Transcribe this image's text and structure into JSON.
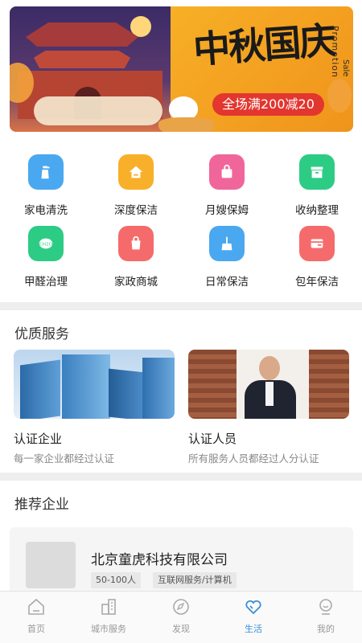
{
  "banner": {
    "title": "中秋国庆",
    "promo_text": "Promotion",
    "sale_text": "Sale",
    "offer": "全场满200减20"
  },
  "services": [
    {
      "label": "家电清洗",
      "icon": "spray-bottle-icon",
      "color": "#4aa8f0"
    },
    {
      "label": "深度保洁",
      "icon": "house-icon",
      "color": "#f8b02a"
    },
    {
      "label": "月嫂保姆",
      "icon": "bag-icon",
      "color": "#f0669b"
    },
    {
      "label": "收纳整理",
      "icon": "storage-box-icon",
      "color": "#2dcc85"
    },
    {
      "label": "甲醛治理",
      "icon": "ch2o-molecule-icon",
      "color": "#2dcc85"
    },
    {
      "label": "家政商城",
      "icon": "shopping-bag-icon",
      "color": "#f56b6b"
    },
    {
      "label": "日常保洁",
      "icon": "broom-icon",
      "color": "#4aa8f0"
    },
    {
      "label": "包年保洁",
      "icon": "card-icon",
      "color": "#f56b6b"
    }
  ],
  "quality": {
    "title": "优质服务",
    "cards": [
      {
        "name": "认证企业",
        "desc": "每一家企业都经过认证"
      },
      {
        "name": "认证人员",
        "desc": "所有服务人员都经过人分认证"
      }
    ]
  },
  "recommend": {
    "title": "推荐企业",
    "company": {
      "name": "北京童虎科技有限公司",
      "tags": [
        "50-100人",
        "互联网服务/计算机"
      ]
    }
  },
  "tabbar": {
    "active_color": "#3a8fd6",
    "tabs": [
      {
        "label": "首页",
        "icon": "home-icon"
      },
      {
        "label": "城市服务",
        "icon": "city-building-icon"
      },
      {
        "label": "发现",
        "icon": "compass-icon"
      },
      {
        "label": "生活",
        "icon": "heart-icon"
      },
      {
        "label": "我的",
        "icon": "user-icon"
      }
    ]
  }
}
